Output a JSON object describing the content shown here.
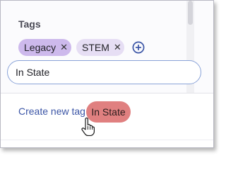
{
  "tags_panel": {
    "title": "Tags",
    "chips": [
      {
        "label": "Legacy",
        "remove_icon": "close-icon",
        "color": "#cdb9ec"
      },
      {
        "label": "STEM",
        "remove_icon": "close-icon",
        "color": "#e6def4"
      }
    ],
    "add_icon": "add-circle-icon",
    "accent_color": "#3b55a6"
  },
  "search": {
    "value": "In State",
    "border_color": "#8aa3d8"
  },
  "create": {
    "link_label": "Create new tag",
    "new_tag_label": "In State",
    "new_tag_color": "#e08080",
    "cursor_icon": "hand-pointer-icon"
  }
}
